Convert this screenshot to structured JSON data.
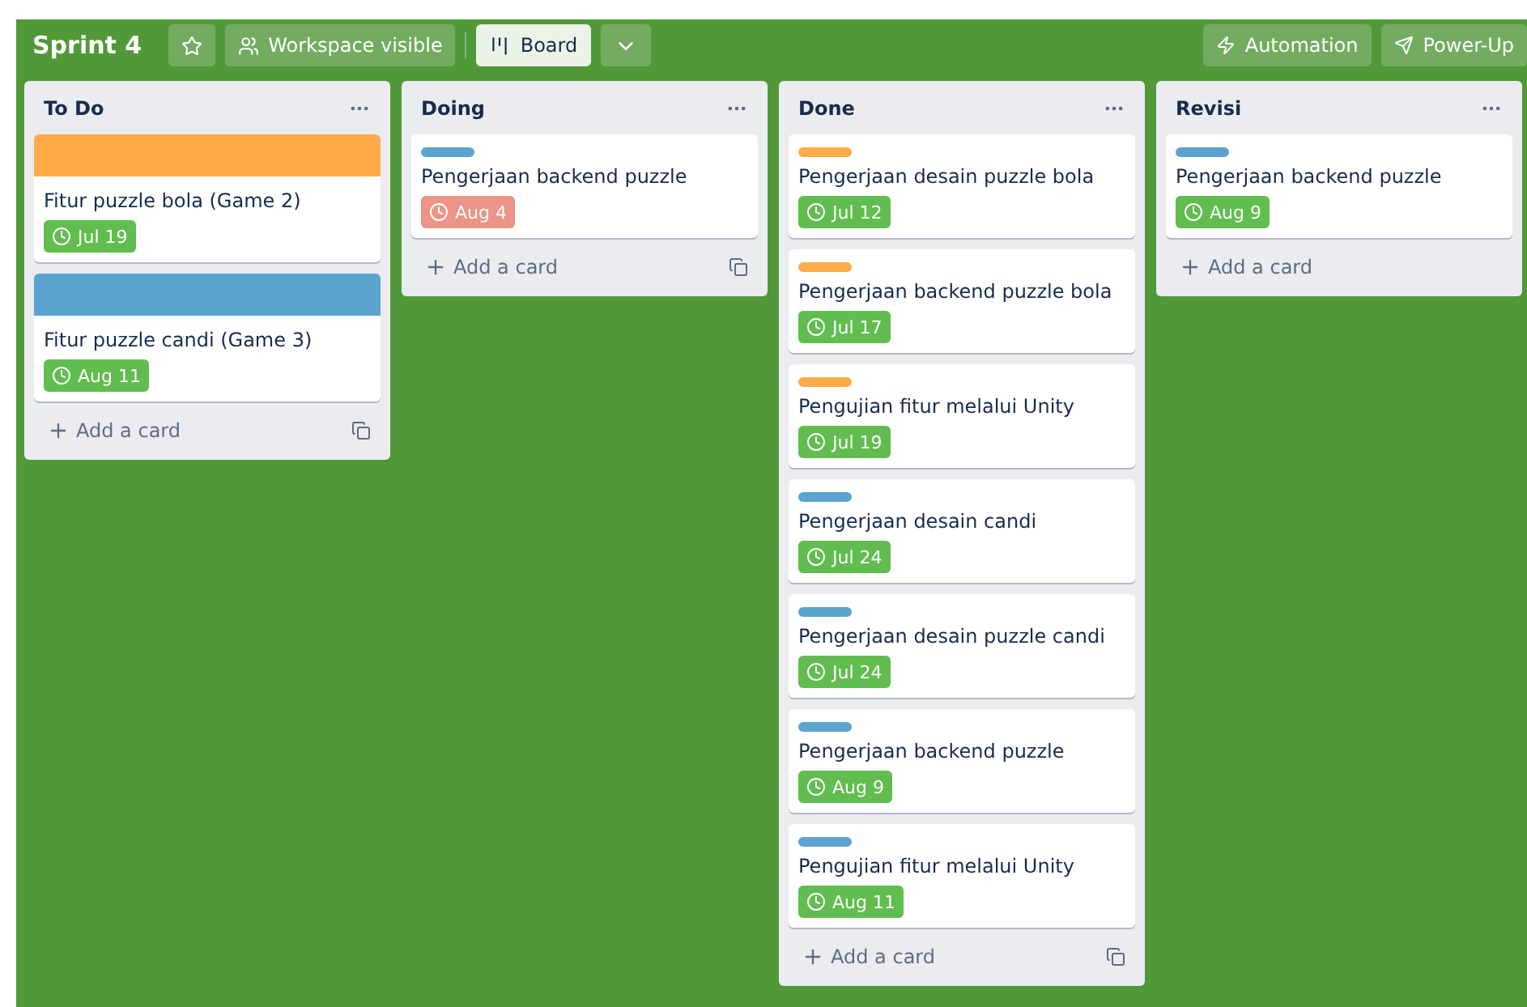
{
  "board": {
    "title": "Sprint 4",
    "visibility": "Workspace visible",
    "view": "Board",
    "actions": [
      {
        "kind": "automation",
        "label": "Automation"
      },
      {
        "kind": "powerups",
        "label": "Power-Up"
      }
    ]
  },
  "lists": [
    {
      "title": "To Do",
      "add_label": "Add a card",
      "template": true,
      "cards": [
        {
          "kind": "cover",
          "color": "#ffab4a",
          "title": "Fitur puzzle bola (Game 2)",
          "due": "Jul 19",
          "overdue": false
        },
        {
          "kind": "cover",
          "color": "#5ba4cf",
          "title": "Fitur puzzle candi (Game 3)",
          "due": "Aug 11",
          "overdue": false
        }
      ]
    },
    {
      "title": "Doing",
      "add_label": "Add a card",
      "template": true,
      "cards": [
        {
          "kind": "label",
          "color": "#5ba4cf",
          "title": "Pengerjaan backend puzzle",
          "due": "Aug 4",
          "overdue": true
        }
      ]
    },
    {
      "title": "Done",
      "add_label": "Add a card",
      "template": true,
      "cards": [
        {
          "kind": "label",
          "color": "#ffab4a",
          "title": "Pengerjaan desain puzzle bola",
          "due": "Jul 12",
          "overdue": false
        },
        {
          "kind": "label",
          "color": "#ffab4a",
          "title": "Pengerjaan backend puzzle bola",
          "due": "Jul 17",
          "overdue": false
        },
        {
          "kind": "label",
          "color": "#ffab4a",
          "title": "Pengujian fitur melalui Unity",
          "due": "Jul 19",
          "overdue": false
        },
        {
          "kind": "label",
          "color": "#5ba4cf",
          "title": "Pengerjaan desain candi",
          "due": "Jul 24",
          "overdue": false
        },
        {
          "kind": "label",
          "color": "#5ba4cf",
          "title": "Pengerjaan desain puzzle candi",
          "due": "Jul 24",
          "overdue": false
        },
        {
          "kind": "label",
          "color": "#5ba4cf",
          "title": "Pengerjaan backend puzzle",
          "due": "Aug 9",
          "overdue": false
        },
        {
          "kind": "label",
          "color": "#5ba4cf",
          "title": "Pengujian fitur melalui Unity",
          "due": "Aug 11",
          "overdue": false
        }
      ]
    },
    {
      "title": "Revisi",
      "add_label": "Add a card",
      "template": false,
      "cards": [
        {
          "kind": "label",
          "color": "#5ba4cf",
          "title": "Pengerjaan backend puzzle",
          "due": "Aug 9",
          "overdue": false
        }
      ]
    }
  ]
}
